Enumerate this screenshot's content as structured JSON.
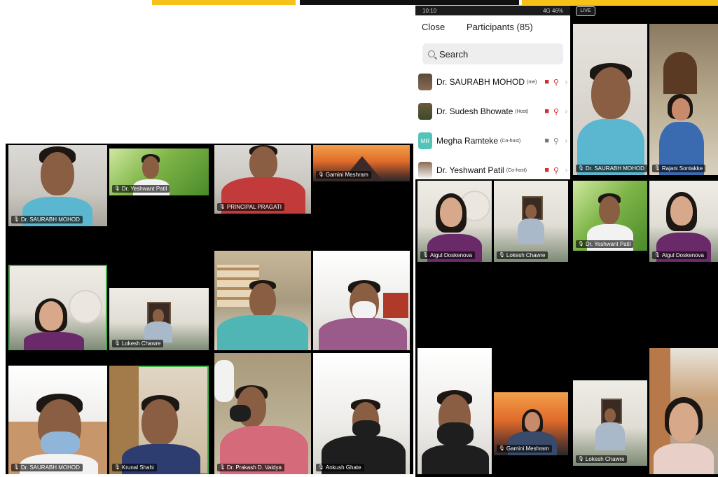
{
  "panel": {
    "status_time": "10:10",
    "status_right": "4G 46%",
    "close_label": "Close",
    "title": "Participants (85)",
    "search_placeholder": "Search",
    "participants": [
      {
        "name": "Dr. SAURABH MOHOD",
        "role": "(me)",
        "video": "off",
        "audio": "muted"
      },
      {
        "name": "Dr. Sudesh Bhowate",
        "role": "(Host)",
        "video": "off",
        "audio": "muted"
      },
      {
        "name": "Megha Ramteke",
        "role": "(Co-host)",
        "video": "off",
        "audio": "muted"
      },
      {
        "name": "Dr. Yeshwant Patil",
        "role": "(Co-host)",
        "video": "off",
        "audio": "muted"
      }
    ]
  },
  "live_badge": "LIVE",
  "tiles": {
    "t1": "Dr. SAURABH MOHOD",
    "t2": "Dr. Yeshwant Patil",
    "t3": "Lokesh Chawre",
    "t4": "PRINCIPAL PRAGATI",
    "t5": "Gamini Meshram",
    "t6": "Dr. SAURABH MOHOD",
    "t7": "Krunal Shahi",
    "t8": "Dr. Prakash D. Vaidya",
    "t9": "Ankush Ghate",
    "t10": "Dr. SAURABH MOHOD",
    "t11": "Rajani Sontakke",
    "t12": "Aigul Doskenova",
    "t13": "Lokesh Chawre",
    "t14": "Dr. Yeshwant Patil",
    "t15": "Aigul Doskenova",
    "t16": "Gamini Meshram",
    "t17": "Lokesh Chawre"
  },
  "colors": {
    "accent_yellow": "#f6c219",
    "active_speaker": "#3fb24a",
    "muted_red": "#d62b2b",
    "host_avatar_teal": "#56c3b8"
  }
}
